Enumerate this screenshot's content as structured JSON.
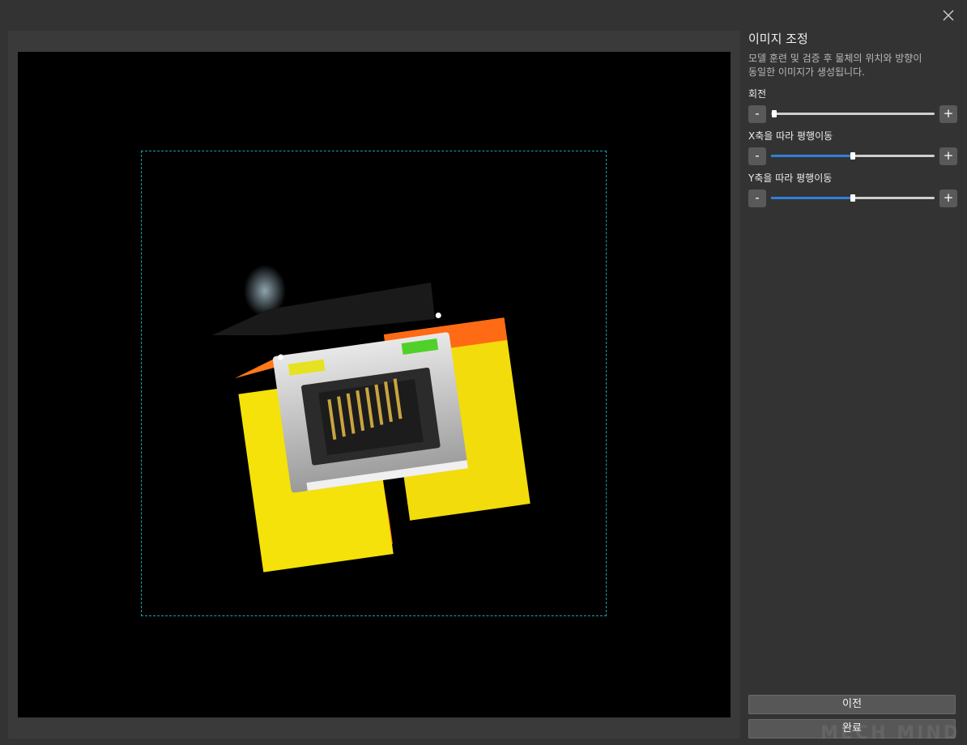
{
  "dialog": {
    "close_icon": "close-icon"
  },
  "panel": {
    "title": "이미지 조정",
    "description_line1": "모델 훈련 및 검증 후 물체의 위치와 방향이",
    "description_line2": "동일한 이미지가 생성됩니다.",
    "controls": [
      {
        "label": "회전",
        "minus": "-",
        "plus": "+",
        "value_fraction": 0.02
      },
      {
        "label": "X축을 따라 평행이동",
        "minus": "-",
        "plus": "+",
        "value_fraction": 0.5
      },
      {
        "label": "Y축을 따라 평행이동",
        "minus": "-",
        "plus": "+",
        "value_fraction": 0.5
      }
    ],
    "prev_button": "이전",
    "done_button": "완료"
  },
  "watermark": "MECH MIND",
  "colors": {
    "accent": "#2f7fdc",
    "roi_border": "#1e9fb0",
    "background": "#333333"
  }
}
